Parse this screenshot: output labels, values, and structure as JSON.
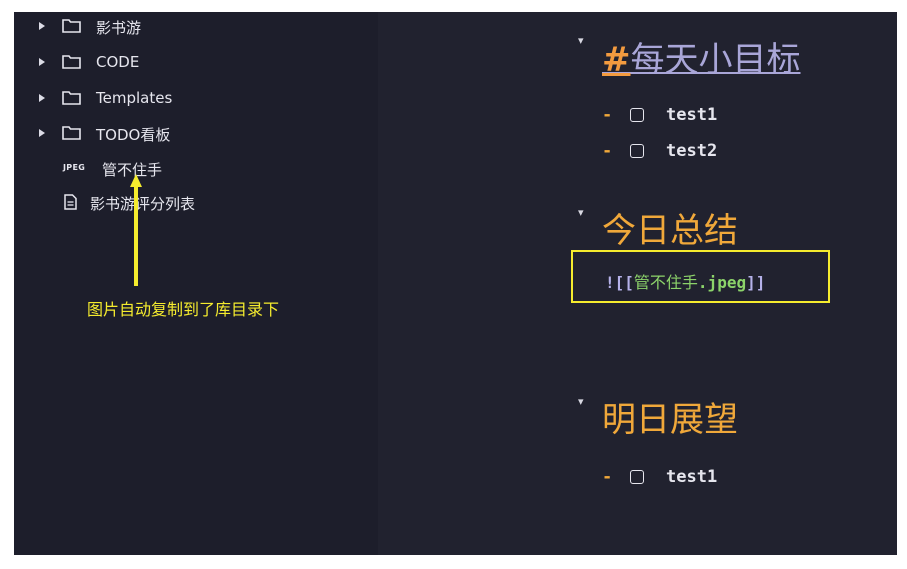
{
  "sidebar": {
    "folders": [
      {
        "label": "影书游"
      },
      {
        "label": "CODE"
      },
      {
        "label": "Templates"
      },
      {
        "label": "TODO看板"
      }
    ],
    "files": [
      {
        "tag": "JPEG",
        "label": "管不住手",
        "icon": "image-file"
      },
      {
        "label": "影书游评分列表",
        "icon": "document-icon"
      }
    ]
  },
  "annotation": {
    "text": "图片自动复制到了库目录下",
    "color": "#f5ec2e"
  },
  "editor": {
    "heading1": {
      "hash": "#",
      "text": "每天小目标"
    },
    "tasks1": [
      {
        "label": "test1"
      },
      {
        "label": "test2"
      }
    ],
    "heading2": {
      "text": "今日总结"
    },
    "embed": {
      "open": "![[",
      "name": "管不住手",
      "ext": ".jpeg",
      "close": "]]"
    },
    "heading3": {
      "text": "明日展望"
    },
    "tasks3": [
      {
        "label": "test1"
      }
    ],
    "dash": "-"
  },
  "colors": {
    "background": "#1e1f2d",
    "heading_accent": "#f0a83a",
    "link_text": "#a9a6d8",
    "annotation": "#f5ec2e"
  }
}
